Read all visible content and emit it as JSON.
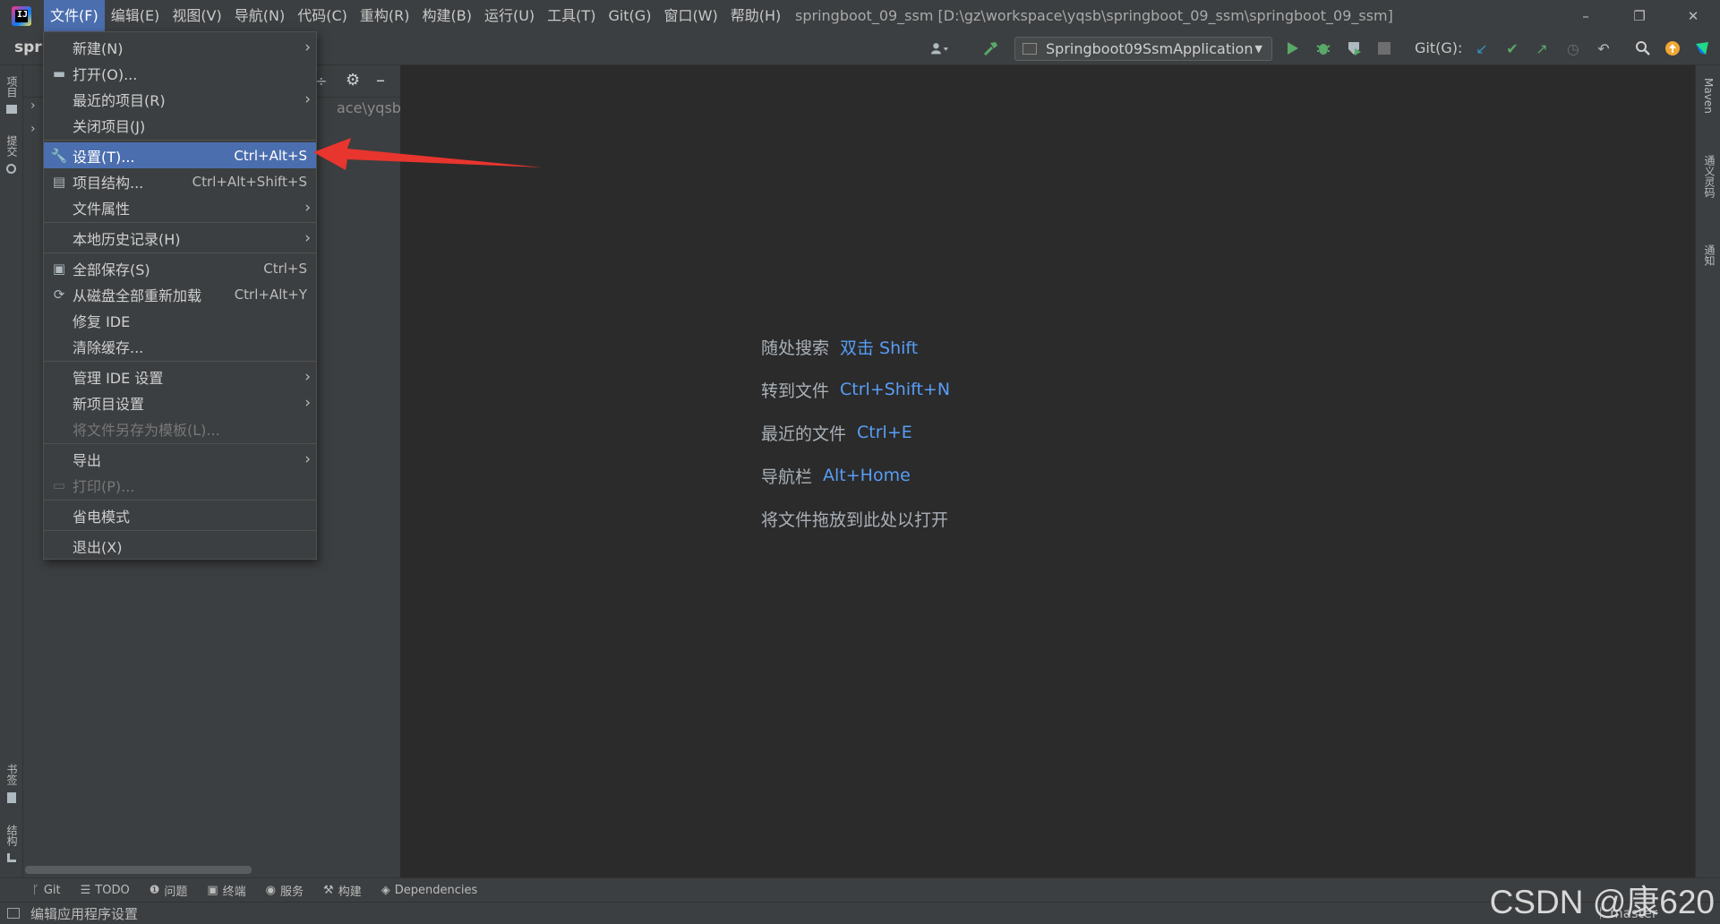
{
  "titlebar": {
    "menus": [
      "文件(F)",
      "编辑(E)",
      "视图(V)",
      "导航(N)",
      "代码(C)",
      "重构(R)",
      "构建(B)",
      "运行(U)",
      "工具(T)",
      "Git(G)",
      "窗口(W)",
      "帮助(H)"
    ],
    "window_title": "springboot_09_ssm [D:\\gz\\workspace\\yqsb\\springboot_09_ssm\\springboot_09_ssm]",
    "minimize": "–",
    "restore": "❐",
    "close": "✕"
  },
  "toolbar": {
    "project_name": "spri",
    "run_config": "Springboot09SsmApplication",
    "git_label": "Git(G):"
  },
  "project_panel": {
    "path_fragment": "ace\\yqsb\\spr"
  },
  "left_stripe": {
    "labels": [
      "项目",
      "提交",
      "书签",
      "结构"
    ]
  },
  "right_stripe": {
    "labels": [
      "Maven",
      "通义灵码",
      "通知"
    ]
  },
  "file_menu": {
    "items": [
      {
        "label": "新建(N)",
        "submenu": true
      },
      {
        "label": "打开(O)...",
        "icon": "folder-icon"
      },
      {
        "label": "最近的项目(R)",
        "submenu": true
      },
      {
        "label": "关闭项目(J)"
      },
      {
        "separator": true
      },
      {
        "label": "设置(T)...",
        "shortcut": "Ctrl+Alt+S",
        "icon": "wrench-icon",
        "selected": true
      },
      {
        "label": "项目结构...",
        "shortcut": "Ctrl+Alt+Shift+S",
        "icon": "project-structure-icon"
      },
      {
        "label": "文件属性",
        "submenu": true
      },
      {
        "separator": true
      },
      {
        "label": "本地历史记录(H)",
        "submenu": true
      },
      {
        "separator": true
      },
      {
        "label": "全部保存(S)",
        "shortcut": "Ctrl+S",
        "icon": "save-icon"
      },
      {
        "label": "从磁盘全部重新加载",
        "shortcut": "Ctrl+Alt+Y",
        "icon": "reload-icon"
      },
      {
        "label": "修复 IDE"
      },
      {
        "label": "清除缓存..."
      },
      {
        "separator": true
      },
      {
        "label": "管理 IDE 设置",
        "submenu": true
      },
      {
        "label": "新项目设置",
        "submenu": true
      },
      {
        "label": "将文件另存为模板(L)...",
        "disabled": true
      },
      {
        "separator": true
      },
      {
        "label": "导出",
        "submenu": true
      },
      {
        "label": "打印(P)...",
        "disabled": true,
        "icon": "print-icon"
      },
      {
        "separator": true
      },
      {
        "label": "省电模式"
      },
      {
        "separator": true
      },
      {
        "label": "退出(X)"
      }
    ]
  },
  "editor_hints": [
    {
      "label": "随处搜索",
      "key": "双击 Shift"
    },
    {
      "label": "转到文件",
      "key": "Ctrl+Shift+N"
    },
    {
      "label": "最近的文件",
      "key": "Ctrl+E"
    },
    {
      "label": "导航栏",
      "key": "Alt+Home"
    },
    {
      "label": "将文件拖放到此处以打开",
      "key": ""
    }
  ],
  "bottom_tabs": [
    {
      "label": "Git",
      "icon": "git-branch-icon"
    },
    {
      "label": "TODO",
      "icon": "list-icon"
    },
    {
      "label": "问题",
      "icon": "info-icon"
    },
    {
      "label": "终端",
      "icon": "terminal-icon"
    },
    {
      "label": "服务",
      "icon": "services-icon"
    },
    {
      "label": "构建",
      "icon": "hammer-icon"
    },
    {
      "label": "Dependencies",
      "icon": "layers-icon"
    }
  ],
  "statusbar": {
    "text": "编辑应用程序设置",
    "branch": "master"
  },
  "watermark": "CSDN @康620",
  "colors": {
    "accent": "#4b6eaf",
    "link": "#589df6",
    "annotation": "#e8352e"
  }
}
